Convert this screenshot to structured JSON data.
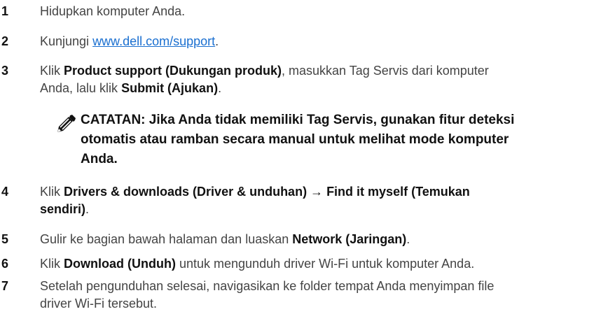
{
  "steps": [
    {
      "num": "1",
      "text": "Hidupkan komputer Anda."
    },
    {
      "num": "2",
      "before": "Kunjungi ",
      "link": "www.dell.com/support",
      "after": "."
    },
    {
      "num": "3",
      "t1": "Klik ",
      "b1": "Product support (Dukungan produk)",
      "t2": ", masukkan Tag Servis dari komputer",
      "t3": "Anda, lalu klik ",
      "b2": "Submit (Ajukan)",
      "t4": "."
    },
    {
      "num": "4",
      "t1": "Klik ",
      "b1": "Drivers & downloads (Driver & unduhan) → Find it myself (Temukan",
      "b2": "sendiri)",
      "t2": "."
    },
    {
      "num": "5",
      "t1": "Gulir ke bagian bawah halaman dan luaskan ",
      "b1": "Network (Jaringan)",
      "t2": "."
    },
    {
      "num": "6",
      "t1": "Klik ",
      "b1": "Download (Unduh)",
      "t2": " untuk mengunduh driver Wi-Fi untuk komputer Anda."
    },
    {
      "num": "7",
      "line1": "Setelah pengunduhan selesai, navigasikan ke folder tempat Anda menyimpan file",
      "line2": "driver Wi-Fi tersebut."
    }
  ],
  "note": {
    "icon": "pencil-note-icon",
    "line1": "CATATAN: Jika Anda tidak memiliki Tag Servis, gunakan fitur deteksi",
    "line2": "otomatis atau ramban secara manual untuk melihat mode komputer",
    "line3": "Anda."
  },
  "colors": {
    "text": "#444444",
    "bold": "#111111",
    "link": "#1a6fd0"
  }
}
